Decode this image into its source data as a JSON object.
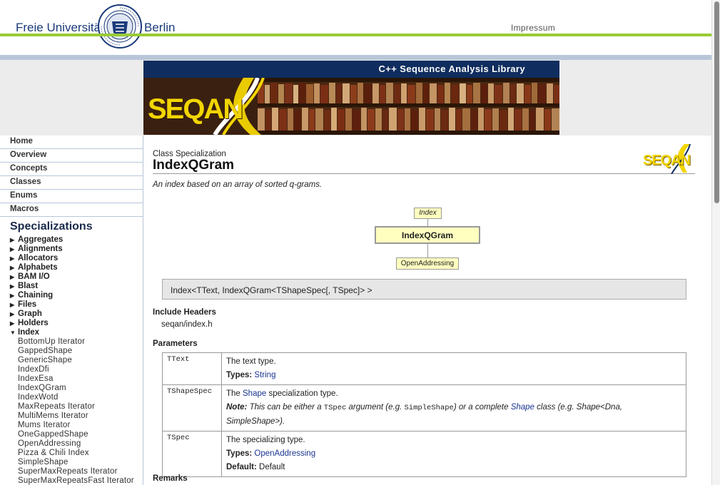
{
  "header": {
    "fu_left": "Freie Universität",
    "fu_right": "Berlin",
    "impressum": "Impressum",
    "seal_text": "VERITAS IUSTITIA LIBERTAS · FREIE UNIVERSITÄT BERLIN"
  },
  "banner": {
    "tagline": "C++ Sequence Analysis Library",
    "logo_text": "SEQAN"
  },
  "nav": {
    "items": [
      "Home",
      "Overview",
      "Concepts",
      "Classes",
      "Enums",
      "Macros"
    ],
    "spec_heading": "Specializations",
    "tree": [
      {
        "label": "Aggregates",
        "expanded": false
      },
      {
        "label": "Alignments",
        "expanded": false
      },
      {
        "label": "Allocators",
        "expanded": false
      },
      {
        "label": "Alphabets",
        "expanded": false
      },
      {
        "label": "BAM I/O",
        "expanded": false
      },
      {
        "label": "Blast",
        "expanded": false
      },
      {
        "label": "Chaining",
        "expanded": false
      },
      {
        "label": "Files",
        "expanded": false
      },
      {
        "label": "Graph",
        "expanded": false
      },
      {
        "label": "Holders",
        "expanded": false
      },
      {
        "label": "Index",
        "expanded": true
      }
    ],
    "index_children": [
      "BottomUp Iterator",
      "GappedShape",
      "GenericShape",
      "IndexDfi",
      "IndexEsa",
      "IndexQGram",
      "IndexWotd",
      "MaxRepeats Iterator",
      "MultiMems Iterator",
      "Mums Iterator",
      "OneGappedShape",
      "OpenAddressing",
      "Pizza & Chili Index",
      "SimpleShape",
      "SuperMaxRepeats Iterator",
      "SuperMaxRepeatsFast Iterator"
    ]
  },
  "page": {
    "kind": "Class Specialization",
    "title": "IndexQGram",
    "summary": "An index based on an array of sorted q-grams.",
    "small_logo": "SEQAN",
    "inheritance": {
      "parent": "Index",
      "self": "IndexQGram",
      "child": "OpenAddressing"
    },
    "signature": "Index<TText, IndexQGram<TShapeSpec[, TSpec]> >",
    "include_heading": "Include Headers",
    "include_file": "seqan/index.h",
    "params_heading": "Parameters",
    "params": [
      {
        "name": "TText",
        "desc": "The text type.",
        "types_label": "Types:",
        "types_value": "String"
      },
      {
        "name": "TShapeSpec",
        "desc_pre": "The ",
        "desc_link": "Shape",
        "desc_post": " specialization type.",
        "note_label": "Note:",
        "note_1": " This can be either a ",
        "note_code1": "TSpec",
        "note_2": " argument (e.g. ",
        "note_code2": "SimpleShape",
        "note_3": ") or a complete ",
        "note_link": "Shape",
        "note_4": " class (e.g. Shape<Dna, SimpleShape>)."
      },
      {
        "name": "TSpec",
        "desc": "The specializing type.",
        "types_label": "Types:",
        "types_value": "OpenAddressing",
        "default_label": "Default:",
        "default_value": "Default"
      }
    ],
    "remarks_heading": "Remarks"
  },
  "colors": {
    "fu_blue": "#1a3a7a",
    "fu_green": "#99cc33",
    "banner_navy": "#0f2d5e",
    "seqan_yellow": "#f2d500",
    "link_blue": "#1a3590",
    "inherit_yellow": "#ffffc0"
  }
}
